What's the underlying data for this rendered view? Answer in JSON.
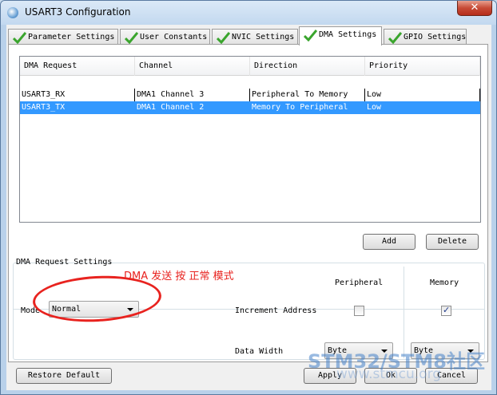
{
  "window": {
    "title": "USART3 Configuration",
    "close_label": "✕"
  },
  "tabs": [
    {
      "label": "Parameter Settings",
      "active": false
    },
    {
      "label": "User Constants",
      "active": false
    },
    {
      "label": "NVIC Settings",
      "active": false
    },
    {
      "label": "DMA Settings",
      "active": true
    },
    {
      "label": "GPIO Settings",
      "active": false
    }
  ],
  "dma_table": {
    "columns": [
      "DMA Request",
      "Channel",
      "Direction",
      "Priority"
    ],
    "rows": [
      {
        "request": "USART3_RX",
        "channel": "DMA1 Channel 3",
        "direction": "Peripheral To Memory",
        "priority": "Low",
        "selected": false
      },
      {
        "request": "USART3_TX",
        "channel": "DMA1 Channel 2",
        "direction": "Memory To Peripheral",
        "priority": "Low",
        "selected": true
      }
    ]
  },
  "table_buttons": {
    "add": "Add",
    "delete": "Delete"
  },
  "request_settings": {
    "group_label": "DMA Request Settings",
    "annotation": "DMA 发送 按 正常 模式",
    "mode_label": "Mode",
    "mode_value": "Normal",
    "peripheral_header": "Peripheral",
    "memory_header": "Memory",
    "increment_label": "Increment Address",
    "increment_peripheral_checked": false,
    "increment_memory_checked": true,
    "check_mark": "✓",
    "data_width_label": "Data Width",
    "peripheral_width": "Byte",
    "memory_width": "Byte"
  },
  "footer": {
    "restore": "Restore Default",
    "apply": "Apply",
    "ok": "Ok",
    "cancel": "Cancel"
  },
  "watermark": {
    "text": "STM32/STM8社区",
    "url": "www.stmcu.org"
  },
  "colors": {
    "selection": "#3399ff",
    "annotation": "#e8231f",
    "tab_check": "#3aa52d"
  }
}
